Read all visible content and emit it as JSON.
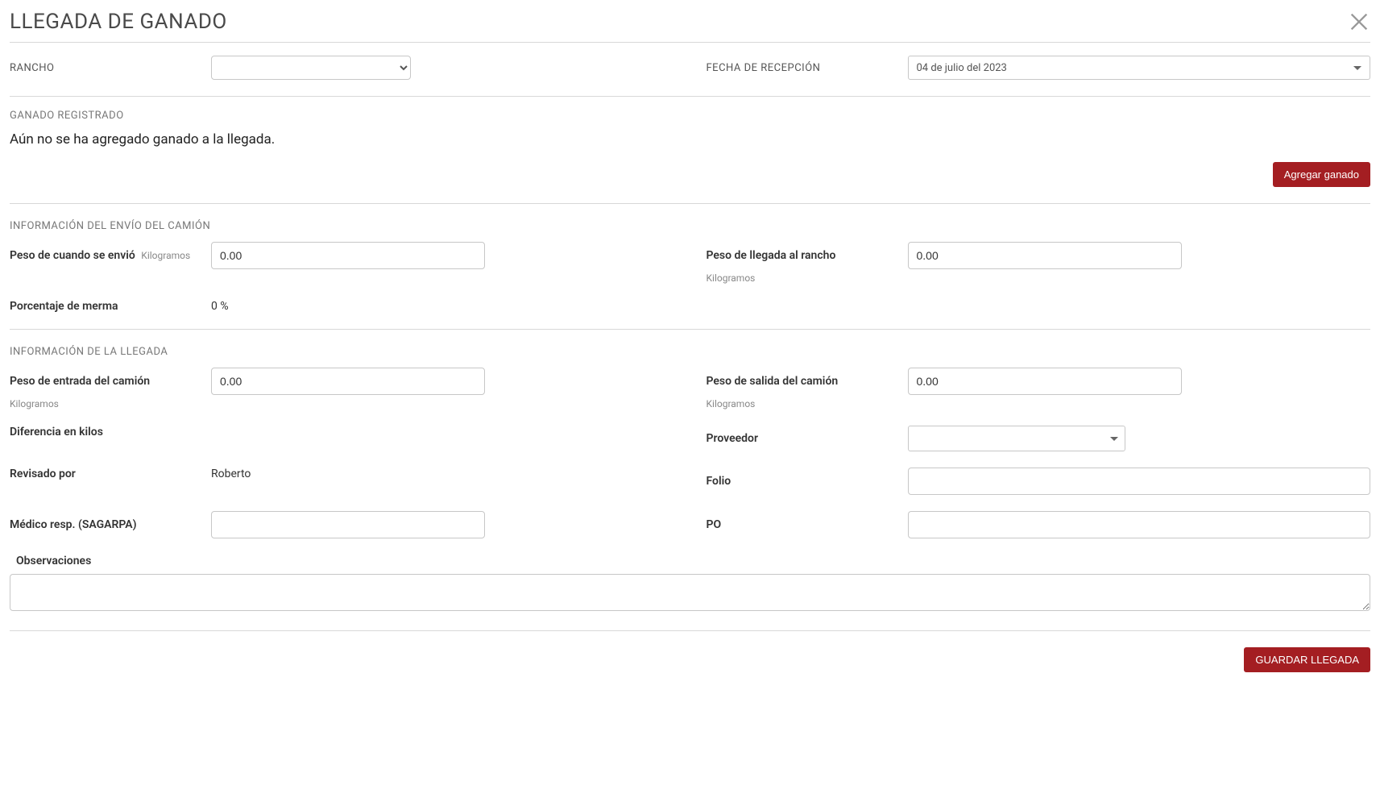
{
  "header": {
    "title": "LLEGADA DE GANADO"
  },
  "topSection": {
    "ranchoLabel": "RANCHO",
    "fechaLabel": "FECHA DE RECEPCIÓN",
    "fechaValue": "04 de julio del  2023"
  },
  "ganado": {
    "sectionLabel": "GANADO REGISTRADO",
    "emptyMessage": "Aún no se ha agregado ganado a la llegada.",
    "addButton": "Agregar ganado"
  },
  "envio": {
    "sectionLabel": "INFORMACIÓN DEL ENVÍO DEL CAMIÓN",
    "pesoEnvioLabel": "Peso de cuando se envió",
    "pesoEnvioUnit": "Kilogramos",
    "pesoEnvioValue": "0.00",
    "pesoLlegadaLabel": "Peso de llegada al rancho",
    "pesoLlegadaUnit": "Kilogramos",
    "pesoLlegadaValue": "0.00",
    "mermaLabel": "Porcentaje de merma",
    "mermaValue": "0 %"
  },
  "llegada": {
    "sectionLabel": "INFORMACIÓN DE LA LLEGADA",
    "pesoEntradaLabel": "Peso de entrada del camión",
    "pesoEntradaUnit": "Kilogramos",
    "pesoEntradaValue": "0.00",
    "pesoSalidaLabel": "Peso de salida del camión",
    "pesoSalidaUnit": "Kilogramos",
    "pesoSalidaValue": "0.00",
    "difKilosLabel": "Diferencia en kilos",
    "proveedorLabel": "Proveedor",
    "revisadoLabel": "Revisado por",
    "revisadoValue": "Roberto",
    "folioLabel": "Folio",
    "medicoLabel": "Médico resp. (SAGARPA)",
    "poLabel": "PO",
    "obsLabel": "Observaciones"
  },
  "footer": {
    "saveButton": "GUARDAR LLEGADA"
  }
}
